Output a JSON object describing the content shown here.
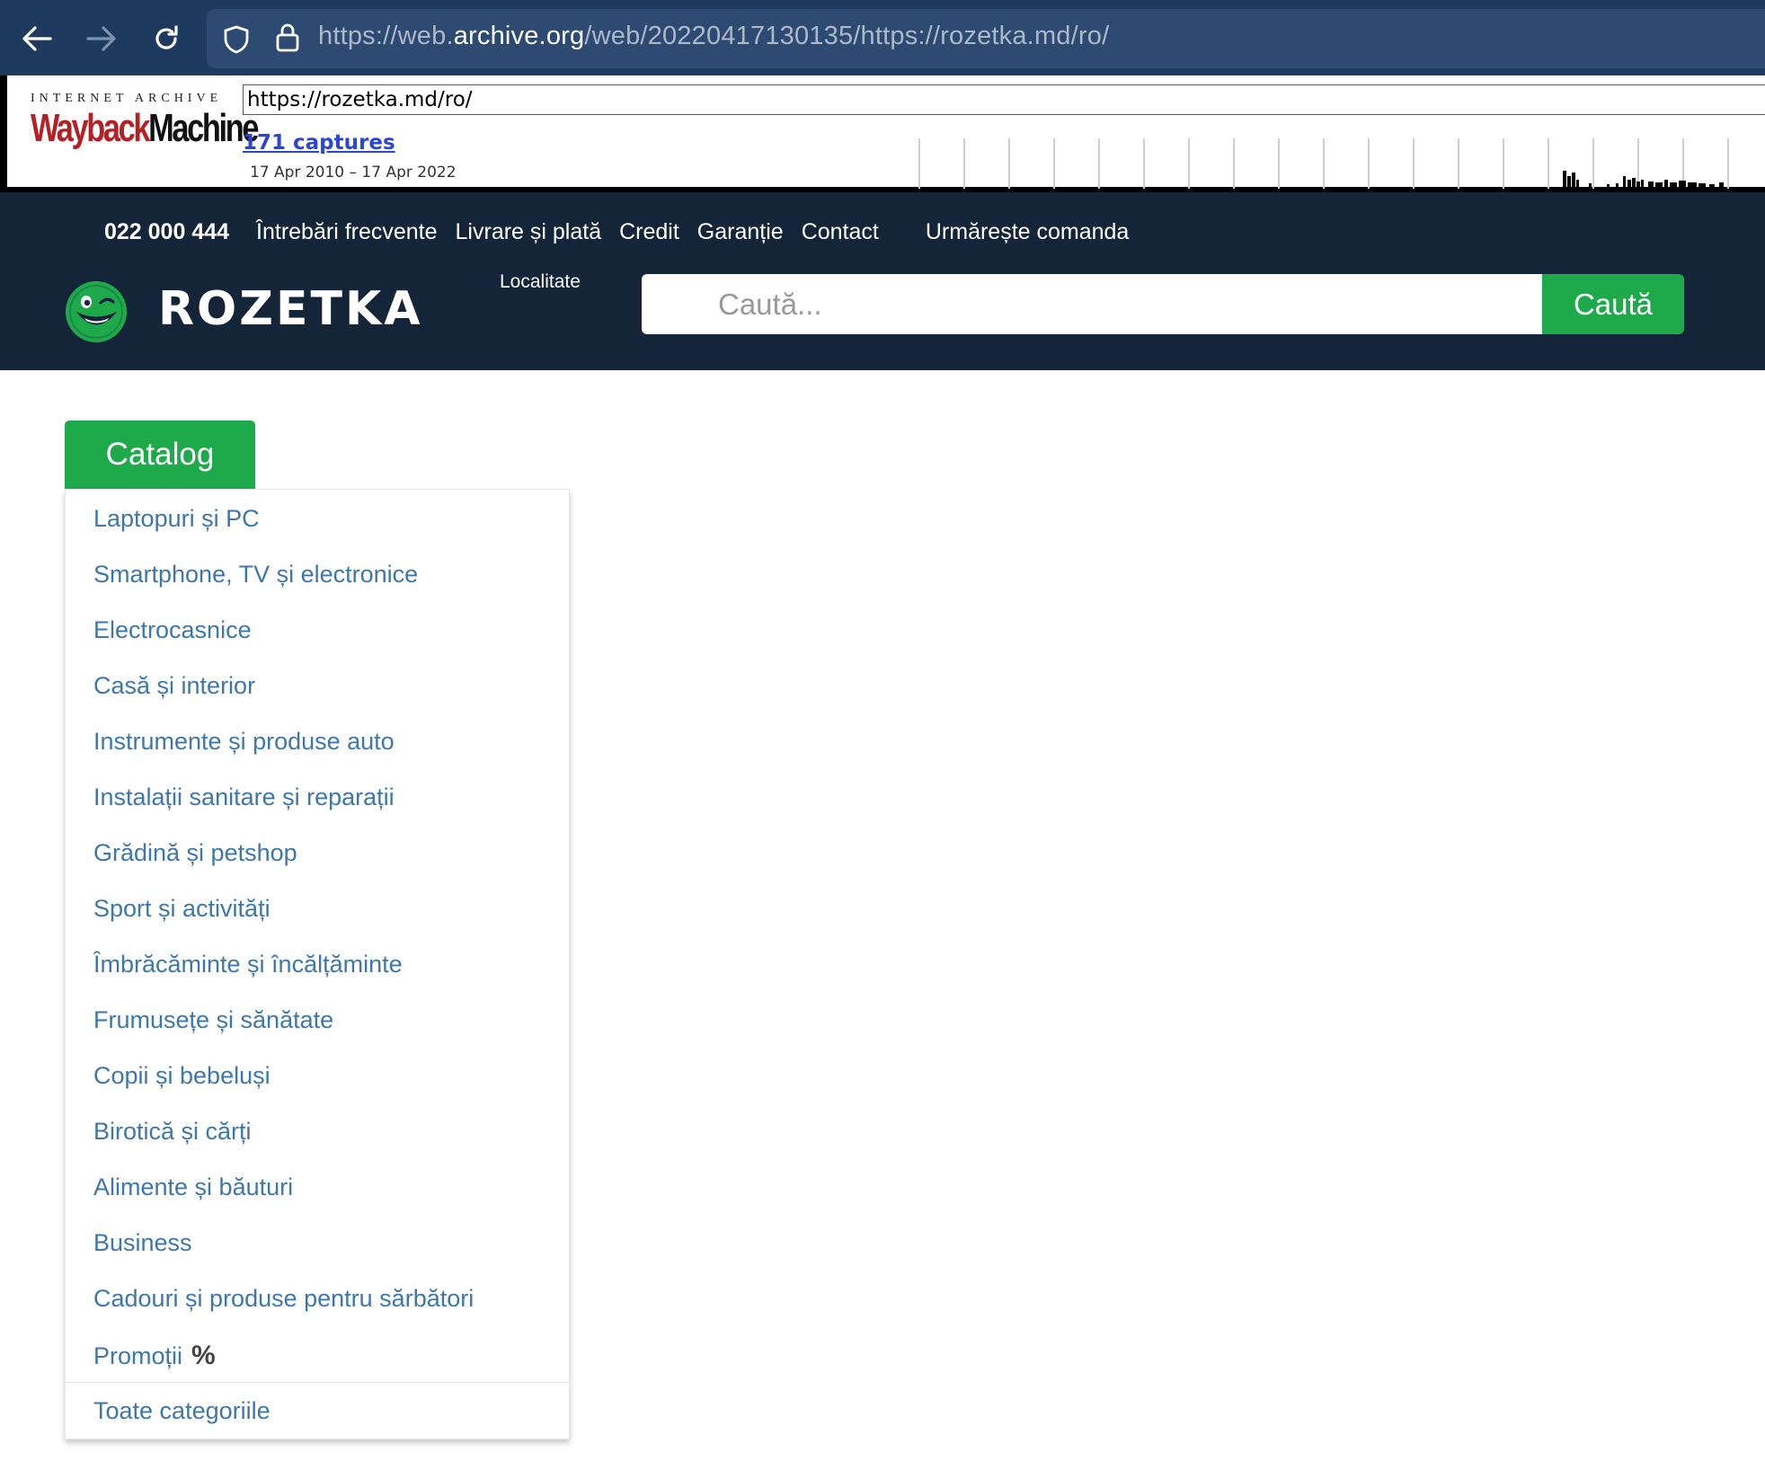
{
  "browser": {
    "url_prefix": "https://web.",
    "url_host": "archive.org",
    "url_suffix": "/web/20220417130135/https://rozetka.md/ro/"
  },
  "wayback": {
    "brand_top": "INTERNET ARCHIVE",
    "brand_word_1": "Wayback",
    "brand_word_2": "Machine",
    "url_value": "https://rozetka.md/ro/",
    "captures": "171 captures",
    "date_range": "17 Apr 2010 – 17 Apr 2022"
  },
  "header": {
    "phone": "022 000 444",
    "links": [
      "Întrebări frecvente",
      "Livrare și plată",
      "Credit",
      "Garanție",
      "Contact"
    ],
    "track_order": "Urmărește comanda",
    "brand": "ROZETKA",
    "location_label": "Localitate",
    "search_placeholder": "Caută...",
    "search_button": "Caută",
    "brand_green": "#1eaa4a",
    "header_bg": "#14253a"
  },
  "catalog": {
    "button_label": "Catalog",
    "items": [
      "Laptopuri și PC",
      "Smartphone, TV și electronice",
      "Electrocasnice",
      "Casă și interior",
      "Instrumente și produse auto",
      "Instalații sanitare și reparații",
      "Grădină și petshop",
      "Sport și activități",
      "Îmbrăcăminte și încălțăminte",
      "Frumusețe și sănătate",
      "Copii și bebeluși",
      "Birotică și cărți",
      "Alimente și băuturi",
      "Business",
      "Cadouri și produse pentru sărbători",
      "Promoții"
    ],
    "promo_icon": "percent-icon",
    "all_categories": "Toate categoriile",
    "link_color": "#3e77aa"
  }
}
